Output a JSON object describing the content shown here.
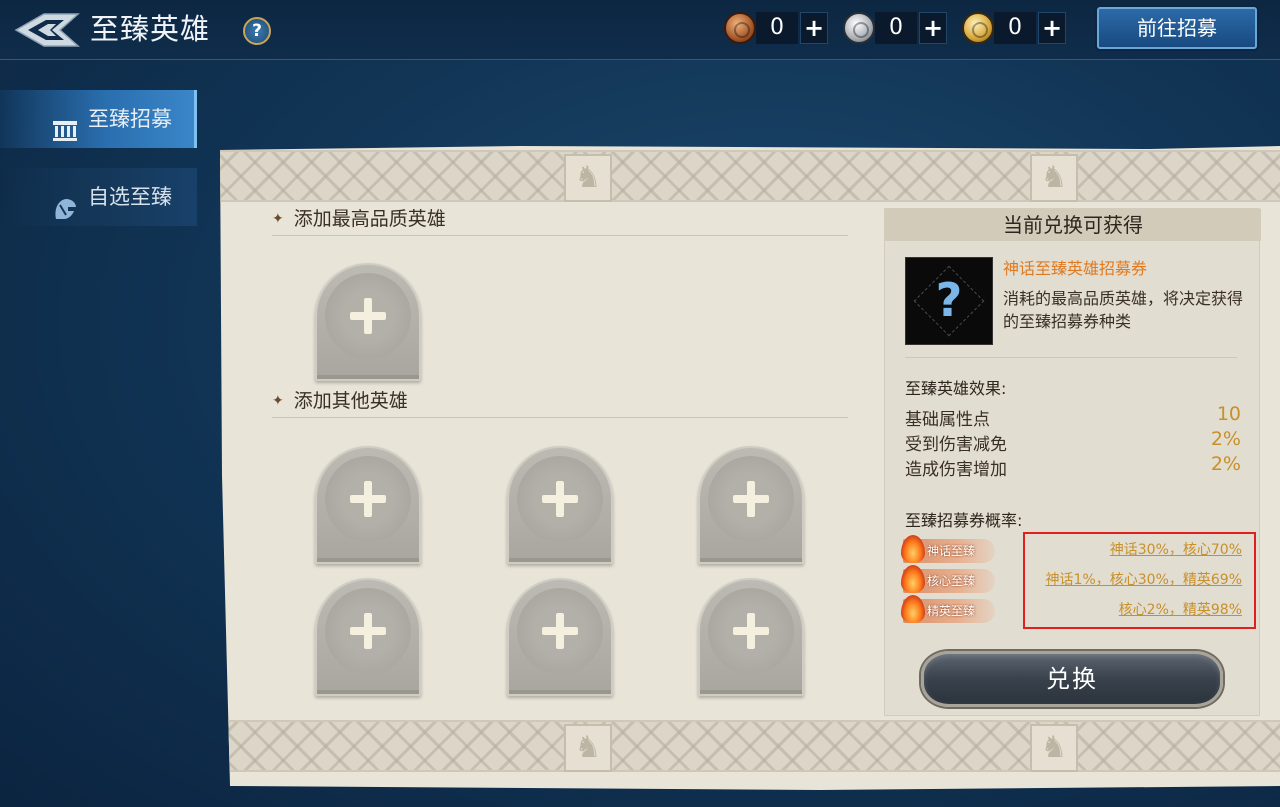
{
  "header": {
    "title": "至臻英雄",
    "help_label": "?",
    "currencies": [
      {
        "icon": "bronze-coin-icon",
        "value": "0",
        "plus": "+"
      },
      {
        "icon": "silver-coin-icon",
        "value": "0",
        "plus": "+"
      },
      {
        "icon": "gold-coin-icon",
        "value": "0",
        "plus": "+"
      }
    ],
    "go_recruit_label": "前往招募"
  },
  "sidebar": {
    "tabs": [
      {
        "label": "至臻招募",
        "icon": "temple-icon",
        "active": true
      },
      {
        "label": "自选至臻",
        "icon": "helmet-icon",
        "active": false
      }
    ]
  },
  "left": {
    "section_top_title": "添加最高品质英雄",
    "section_bottom_title": "添加其他英雄",
    "star_glyph": "✦"
  },
  "reward": {
    "title": "当前兑换可获得",
    "ticket_name": "神话至臻英雄招募券",
    "ticket_desc": "消耗的最高品质英雄，将决定获得的至臻招募券种类",
    "ticket_glyph": "?",
    "effects_title": "至臻英雄效果:",
    "effects": [
      {
        "name": "基础属性点",
        "value": "10"
      },
      {
        "name": "受到伤害减免",
        "value": "2%"
      },
      {
        "name": "造成伤害增加",
        "value": "2%"
      }
    ],
    "prob_title": "至臻招募券概率:",
    "probabilities": [
      {
        "badge": "神话至臻",
        "rate": "神话30%，核心70%"
      },
      {
        "badge": "核心至臻",
        "rate": "神话1%，核心30%，精英69%"
      },
      {
        "badge": "精英至臻",
        "rate": "核心2%，精英98%"
      }
    ],
    "exchange_label": "兑换"
  },
  "colors": {
    "accent_orange": "#e07a20",
    "value_gold": "#c89028",
    "highlight_red": "#e02020",
    "tab_active_blue": "#2a6fb0"
  }
}
